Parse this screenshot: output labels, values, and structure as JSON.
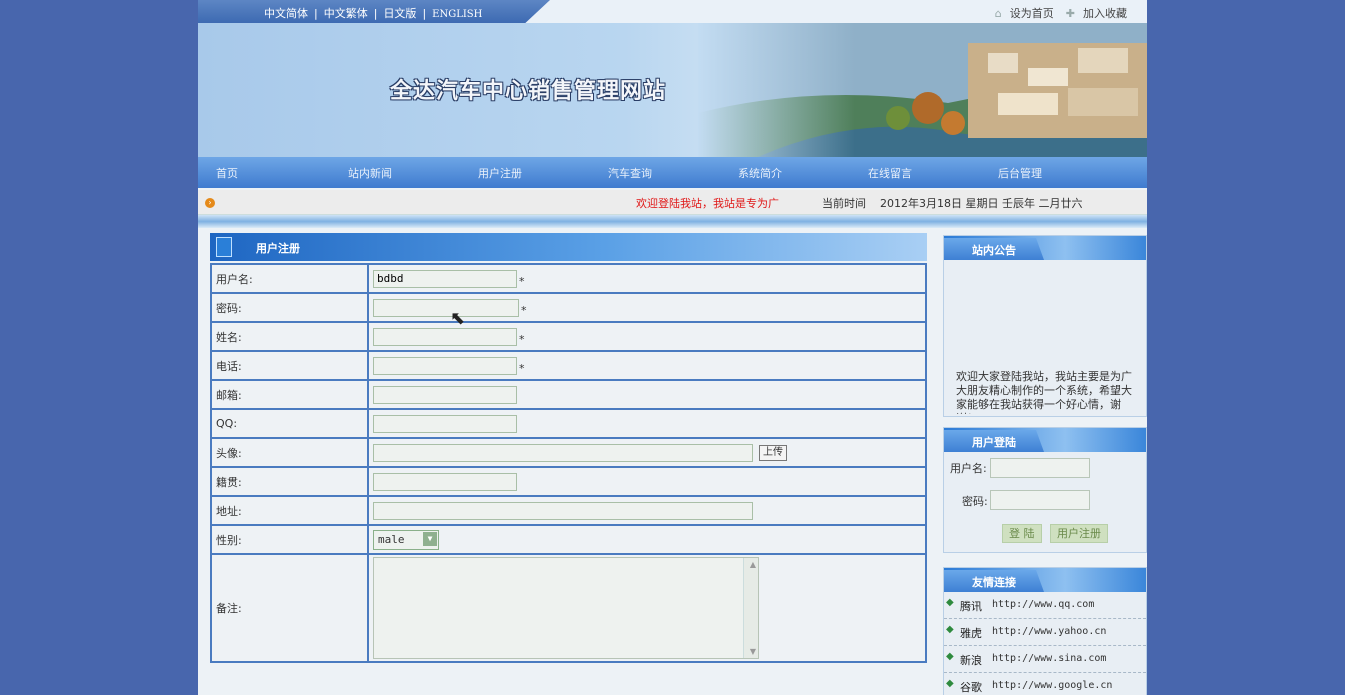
{
  "top_bar": {
    "lang_links": [
      "中文简体",
      "中文繁体",
      "日文版",
      "ENGLISH"
    ],
    "set_home": "设为首页",
    "add_favorite": "加入收藏"
  },
  "banner": {
    "title": "全达汽车中心销售管理网站"
  },
  "nav": {
    "items": [
      "首页",
      "站内新闻",
      "用户注册",
      "汽车查询",
      "系统简介",
      "在线留言",
      "后台管理"
    ]
  },
  "ticker": {
    "message": "欢迎登陆我站，我站是专为广",
    "date_label": "当前时间",
    "date_value": "2012年3月18日 星期日 壬辰年 二月廿六"
  },
  "registration": {
    "title": "用户注册",
    "fields": {
      "username": {
        "label": "用户名:",
        "value": "bdbd",
        "required": "*"
      },
      "password": {
        "label": "密码:",
        "value": "",
        "required": "*"
      },
      "name": {
        "label": "姓名:",
        "value": "",
        "required": "*"
      },
      "phone": {
        "label": "电话:",
        "value": "",
        "required": "*"
      },
      "email": {
        "label": "邮箱:",
        "value": ""
      },
      "qq": {
        "label": "QQ:",
        "value": ""
      },
      "avatar": {
        "label": "头像:",
        "value": "",
        "upload": "上传"
      },
      "hometown": {
        "label": "籍贯:",
        "value": ""
      },
      "address": {
        "label": "地址:",
        "value": ""
      },
      "gender": {
        "label": "性别:",
        "value": "male"
      },
      "remarks": {
        "label": "备注:",
        "value": ""
      }
    }
  },
  "sidebar": {
    "notice": {
      "title": "站内公告",
      "text": "欢迎大家登陆我站，我站主要是为广大朋友精心制作的一个系统，希望大家能够在我站获得一个好心情，谢谢！"
    },
    "login": {
      "title": "用户登陆",
      "username_label": "用户名:",
      "password_label": "密码:",
      "login_button": "登 陆",
      "register_button": "用户注册"
    },
    "links": {
      "title": "友情连接",
      "items": [
        {
          "name": "腾讯",
          "url": "http://www.qq.com"
        },
        {
          "name": "雅虎",
          "url": "http://www.yahoo.cn"
        },
        {
          "name": "新浪",
          "url": "http://www.sina.com"
        },
        {
          "name": "谷歌",
          "url": "http://www.google.cn"
        }
      ]
    }
  }
}
